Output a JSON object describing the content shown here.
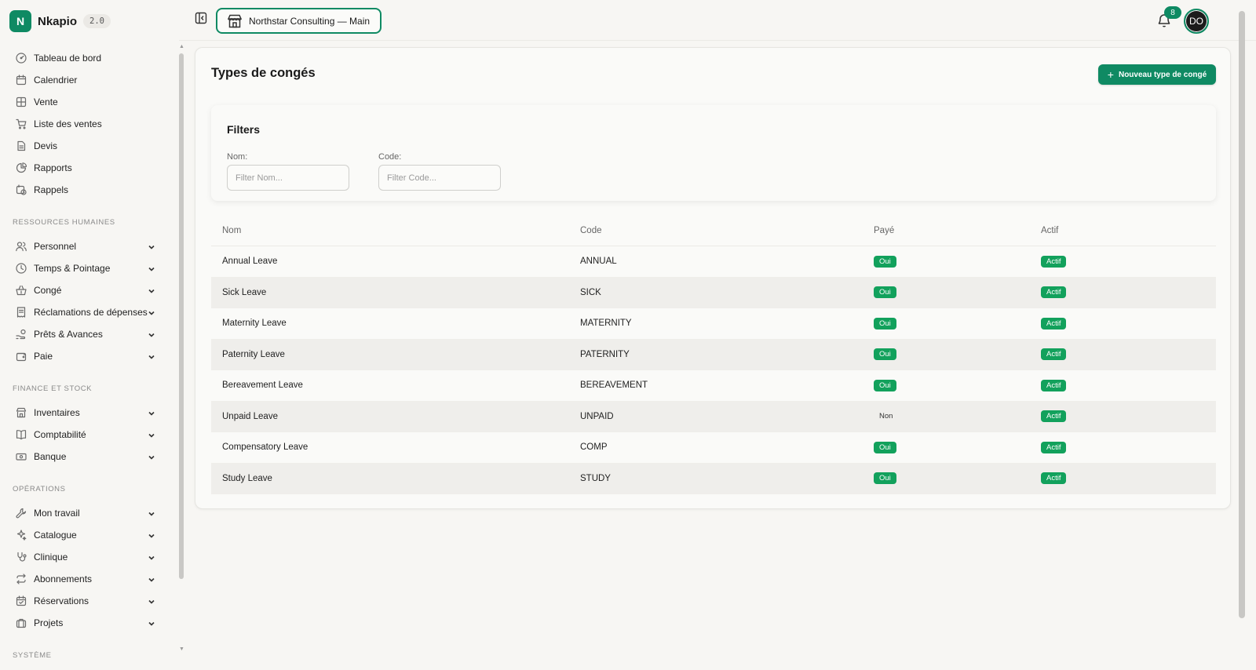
{
  "app": {
    "name": "Nkapio",
    "version": "2.0",
    "logo_letter": "N"
  },
  "sidebar": {
    "main_items": [
      {
        "label": "Tableau de bord",
        "icon": "gauge-icon"
      },
      {
        "label": "Calendrier",
        "icon": "calendar-icon"
      },
      {
        "label": "Vente",
        "icon": "grid-icon"
      },
      {
        "label": "Liste des ventes",
        "icon": "cart-icon"
      },
      {
        "label": "Devis",
        "icon": "document-icon"
      },
      {
        "label": "Rapports",
        "icon": "pie-chart-icon"
      },
      {
        "label": "Rappels",
        "icon": "calendar-clock-icon"
      }
    ],
    "sections": [
      {
        "title": "RESSOURCES HUMAINES",
        "items": [
          {
            "label": "Personnel",
            "icon": "users-icon"
          },
          {
            "label": "Temps & Pointage",
            "icon": "clock-icon"
          },
          {
            "label": "Congé",
            "icon": "basket-icon"
          },
          {
            "label": "Réclamations de dépenses",
            "icon": "receipt-icon"
          },
          {
            "label": "Prêts & Avances",
            "icon": "hand-coins-icon"
          },
          {
            "label": "Paie",
            "icon": "wallet-icon"
          }
        ]
      },
      {
        "title": "FINANCE ET STOCK",
        "items": [
          {
            "label": "Inventaires",
            "icon": "store-icon"
          },
          {
            "label": "Comptabilité",
            "icon": "book-icon"
          },
          {
            "label": "Banque",
            "icon": "banknote-icon"
          }
        ]
      },
      {
        "title": "OPÉRATIONS",
        "items": [
          {
            "label": "Mon travail",
            "icon": "wrench-icon"
          },
          {
            "label": "Catalogue",
            "icon": "sparkles-icon"
          },
          {
            "label": "Clinique",
            "icon": "stethoscope-icon"
          },
          {
            "label": "Abonnements",
            "icon": "repeat-icon"
          },
          {
            "label": "Réservations",
            "icon": "calendar-check-icon"
          },
          {
            "label": "Projets",
            "icon": "briefcase-icon"
          }
        ]
      },
      {
        "title": "SYSTÈME",
        "items": []
      }
    ]
  },
  "topbar": {
    "tenant": "Northstar Consulting — Main",
    "notifications": "8",
    "avatar_initials": "DO"
  },
  "main": {
    "title": "Types de congés",
    "new_button": "Nouveau type de congé",
    "filters": {
      "title": "Filters",
      "name_label": "Nom:",
      "name_placeholder": "Filter Nom...",
      "code_label": "Code:",
      "code_placeholder": "Filter Code..."
    },
    "table": {
      "headers": [
        "Nom",
        "Code",
        "Payé",
        "Actif"
      ],
      "rows": [
        {
          "name": "Annual Leave",
          "code": "ANNUAL",
          "paid": "Oui",
          "active": "Actif"
        },
        {
          "name": "Sick Leave",
          "code": "SICK",
          "paid": "Oui",
          "active": "Actif"
        },
        {
          "name": "Maternity Leave",
          "code": "MATERNITY",
          "paid": "Oui",
          "active": "Actif"
        },
        {
          "name": "Paternity Leave",
          "code": "PATERNITY",
          "paid": "Oui",
          "active": "Actif"
        },
        {
          "name": "Bereavement Leave",
          "code": "BEREAVEMENT",
          "paid": "Oui",
          "active": "Actif"
        },
        {
          "name": "Unpaid Leave",
          "code": "UNPAID",
          "paid": "Non",
          "active": "Actif"
        },
        {
          "name": "Compensatory Leave",
          "code": "COMP",
          "paid": "Oui",
          "active": "Actif"
        },
        {
          "name": "Study Leave",
          "code": "STUDY",
          "paid": "Oui",
          "active": "Actif"
        }
      ]
    }
  },
  "colors": {
    "accent": "#0f8a63",
    "badge_green": "#12a15c",
    "background": "#f7f6f3"
  }
}
